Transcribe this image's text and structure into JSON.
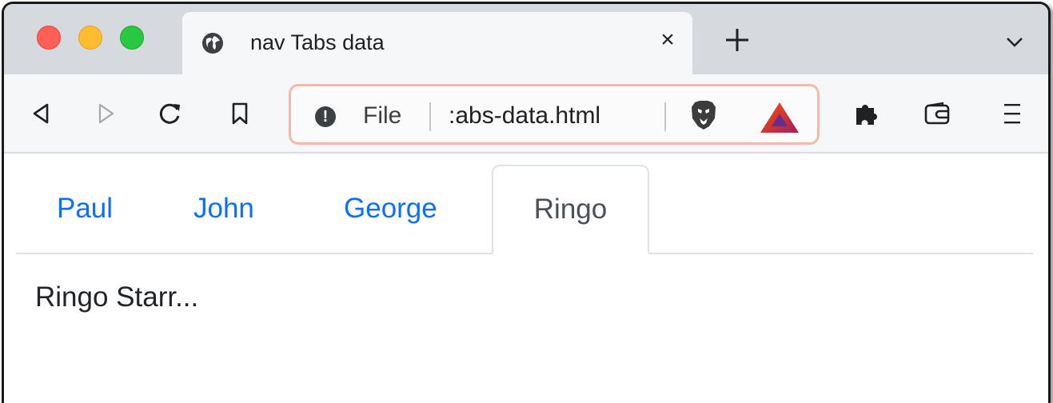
{
  "browser": {
    "tab_title": "nav Tabs data",
    "tab_close_glyph": "×",
    "address": {
      "scheme_label": "File",
      "info_glyph": "!",
      "url_text": ":abs-data.html"
    },
    "icons": [
      "globe-icon",
      "close-icon",
      "new-tab-icon",
      "chevron-down-icon",
      "back-icon",
      "forward-icon",
      "reload-icon",
      "bookmark-icon",
      "info-icon",
      "brave-shields-icon",
      "brave-rewards-icon",
      "extensions-icon",
      "wallet-icon",
      "menu-icon"
    ],
    "colors": {
      "traffic_red": "#ff5f57",
      "traffic_yellow": "#febc2e",
      "traffic_green": "#28c840",
      "urlbar_focus_border": "#f6b8a8"
    }
  },
  "page": {
    "tabs": [
      {
        "label": "Paul",
        "active": false
      },
      {
        "label": "John",
        "active": false
      },
      {
        "label": "George",
        "active": false
      },
      {
        "label": "Ringo",
        "active": true
      }
    ],
    "content": "Ringo Starr...",
    "colors": {
      "link": "#0d6efd",
      "active_tab_text": "#495057",
      "tab_border": "#dee2e6"
    }
  }
}
